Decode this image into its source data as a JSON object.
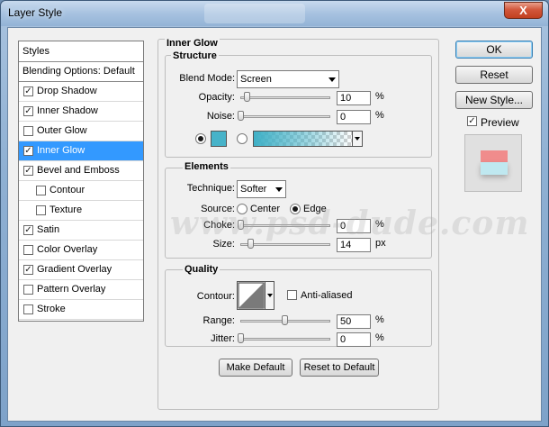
{
  "window": {
    "title": "Layer Style",
    "close_label": "X"
  },
  "colors": {
    "selection": "#3399ff",
    "glow_swatch": "#47b3c9",
    "gradient_start": "#3fb0c6",
    "preview_top": "#f08c8c",
    "preview_bottom": "#bfe8f0"
  },
  "sidebar": {
    "header": "Styles",
    "blending": "Blending Options: Default",
    "items": [
      {
        "label": "Drop Shadow",
        "checked": true,
        "sub": false,
        "active": false
      },
      {
        "label": "Inner Shadow",
        "checked": true,
        "sub": false,
        "active": false
      },
      {
        "label": "Outer Glow",
        "checked": false,
        "sub": false,
        "active": false
      },
      {
        "label": "Inner Glow",
        "checked": true,
        "sub": false,
        "active": true
      },
      {
        "label": "Bevel and Emboss",
        "checked": true,
        "sub": false,
        "active": false
      },
      {
        "label": "Contour",
        "checked": false,
        "sub": true,
        "active": false
      },
      {
        "label": "Texture",
        "checked": false,
        "sub": true,
        "active": false
      },
      {
        "label": "Satin",
        "checked": true,
        "sub": false,
        "active": false
      },
      {
        "label": "Color Overlay",
        "checked": false,
        "sub": false,
        "active": false
      },
      {
        "label": "Gradient Overlay",
        "checked": true,
        "sub": false,
        "active": false
      },
      {
        "label": "Pattern Overlay",
        "checked": false,
        "sub": false,
        "active": false
      },
      {
        "label": "Stroke",
        "checked": false,
        "sub": false,
        "active": false
      }
    ]
  },
  "panel": {
    "title": "Inner Glow",
    "structure": {
      "title": "Structure",
      "blend_mode_label": "Blend Mode:",
      "blend_mode_value": "Screen",
      "opacity_label": "Opacity:",
      "opacity_value": "10",
      "noise_label": "Noise:",
      "noise_value": "0",
      "unit": "%"
    },
    "elements": {
      "title": "Elements",
      "technique_label": "Technique:",
      "technique_value": "Softer",
      "source_label": "Source:",
      "source_center": "Center",
      "source_edge": "Edge",
      "choke_label": "Choke:",
      "choke_value": "0",
      "size_label": "Size:",
      "size_value": "14",
      "pct": "%",
      "px": "px"
    },
    "quality": {
      "title": "Quality",
      "contour_label": "Contour:",
      "antialiased_label": "Anti-aliased",
      "range_label": "Range:",
      "range_value": "50",
      "jitter_label": "Jitter:",
      "jitter_value": "0",
      "unit": "%"
    },
    "make_default": "Make Default",
    "reset_default": "Reset to Default"
  },
  "buttons": {
    "ok": "OK",
    "reset": "Reset",
    "new_style": "New Style...",
    "preview": "Preview"
  },
  "watermark": "www.psd-dude.com"
}
